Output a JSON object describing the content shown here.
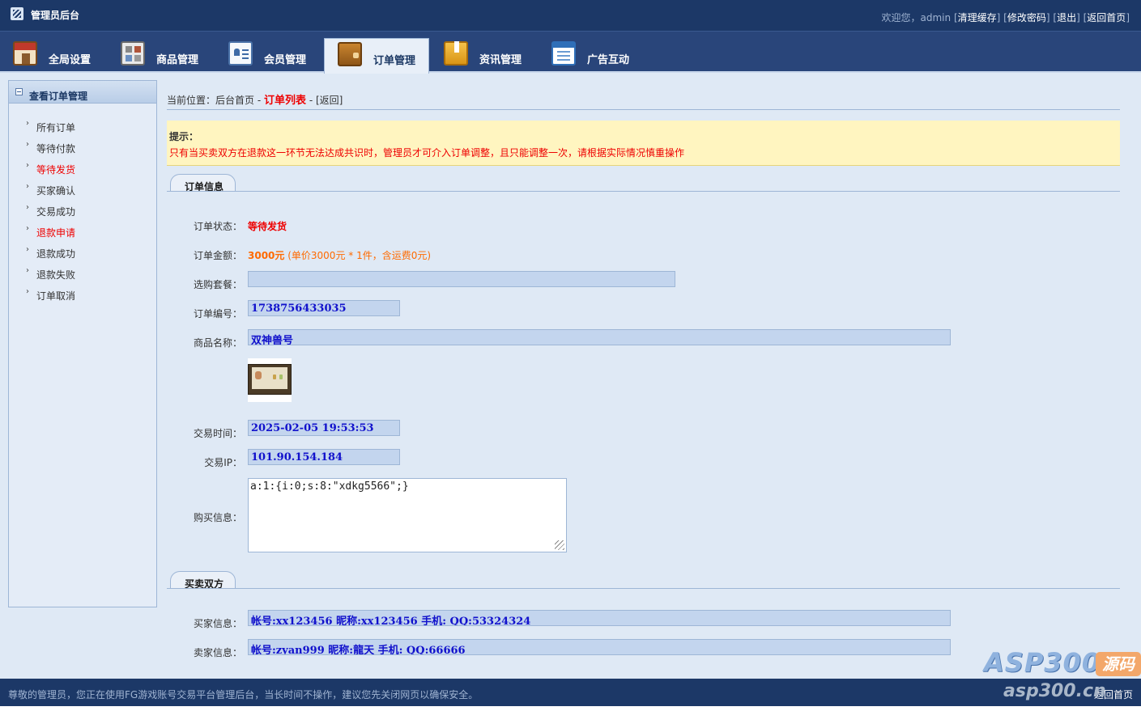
{
  "header": {
    "app_title": "管理员后台",
    "welcome": "欢迎您，admin",
    "links": [
      "清理缓存",
      "修改密码",
      "退出",
      "返回首页"
    ]
  },
  "nav": {
    "tabs": [
      {
        "label": "全局设置",
        "icon": "home-icon",
        "active": false
      },
      {
        "label": "商品管理",
        "icon": "grid-icon",
        "active": false
      },
      {
        "label": "会员管理",
        "icon": "member-card-icon",
        "active": false
      },
      {
        "label": "订单管理",
        "icon": "wallet-icon",
        "active": true
      },
      {
        "label": "资讯管理",
        "icon": "bookmark-icon",
        "active": false
      },
      {
        "label": "广告互动",
        "icon": "list-window-icon",
        "active": false
      }
    ]
  },
  "sidebar": {
    "title": "查看订单管理",
    "items": [
      {
        "label": "所有订单",
        "highlight": false
      },
      {
        "label": "等待付款",
        "highlight": false
      },
      {
        "label": "等待发货",
        "highlight": true
      },
      {
        "label": "买家确认",
        "highlight": false
      },
      {
        "label": "交易成功",
        "highlight": false
      },
      {
        "label": "退款申请",
        "highlight": true
      },
      {
        "label": "退款成功",
        "highlight": false
      },
      {
        "label": "退款失败",
        "highlight": false
      },
      {
        "label": "订单取消",
        "highlight": false
      }
    ]
  },
  "breadcrumb": {
    "prefix": "当前位置：",
    "home": "后台首页",
    "sep1": " - ",
    "current": "订单列表",
    "sep2": " - ",
    "back": "[返回]"
  },
  "tip": {
    "title": "提示：",
    "text": "只有当买卖双方在退款这一环节无法达成共识时，管理员才可介入订单调整，且只能调整一次，请根据实际情况慎重操作"
  },
  "order_info": {
    "section_title": "订单信息",
    "status_label": "订单状态：",
    "status_value": "等待发货",
    "amount_label": "订单金额：",
    "amount_value": "3000元",
    "amount_detail": " (单价3000元 * 1件，含运费0元)",
    "package_label": "选购套餐：",
    "package_value": "",
    "order_no_label": "订单编号：",
    "order_no_value": "1738756433035",
    "goods_name_label": "商品名称：",
    "goods_name_value": "双神兽号",
    "trade_time_label": "交易时间：",
    "trade_time_value": "2025-02-05 19:53:53",
    "trade_ip_label": "交易IP：",
    "trade_ip_value": "101.90.154.184",
    "purchase_info_label": "购买信息：",
    "purchase_info_value": "a:1:{i:0;s:8:\"xdkg5566\";}"
  },
  "parties": {
    "section_title": "买卖双方",
    "buyer_label": "买家信息：",
    "buyer_value": "帐号:xx123456 昵称:xx123456 手机: QQ:53324324",
    "seller_label": "卖家信息：",
    "seller_value": "帐号:zyan999 昵称:龍天 手机: QQ:66666"
  },
  "footer": {
    "notice": "尊敬的管理员，您正在使用FG游戏账号交易平台管理后台，当长时间不操作，建议您先关闭网页以确保安全。",
    "home_link": "返回首页"
  },
  "watermark": {
    "big": "ASP300",
    "box": "源码",
    "small": "asp300.cn"
  },
  "colors": {
    "header_bg": "#1c3867",
    "nav_bg": "#29457a",
    "page_bg": "#dfe9f5",
    "field_bg": "#c3d5ee",
    "field_text": "#1111cc",
    "alert_red": "#ee0000",
    "amount_orange": "#ff6a00",
    "tip_bg": "#fff5c0"
  }
}
